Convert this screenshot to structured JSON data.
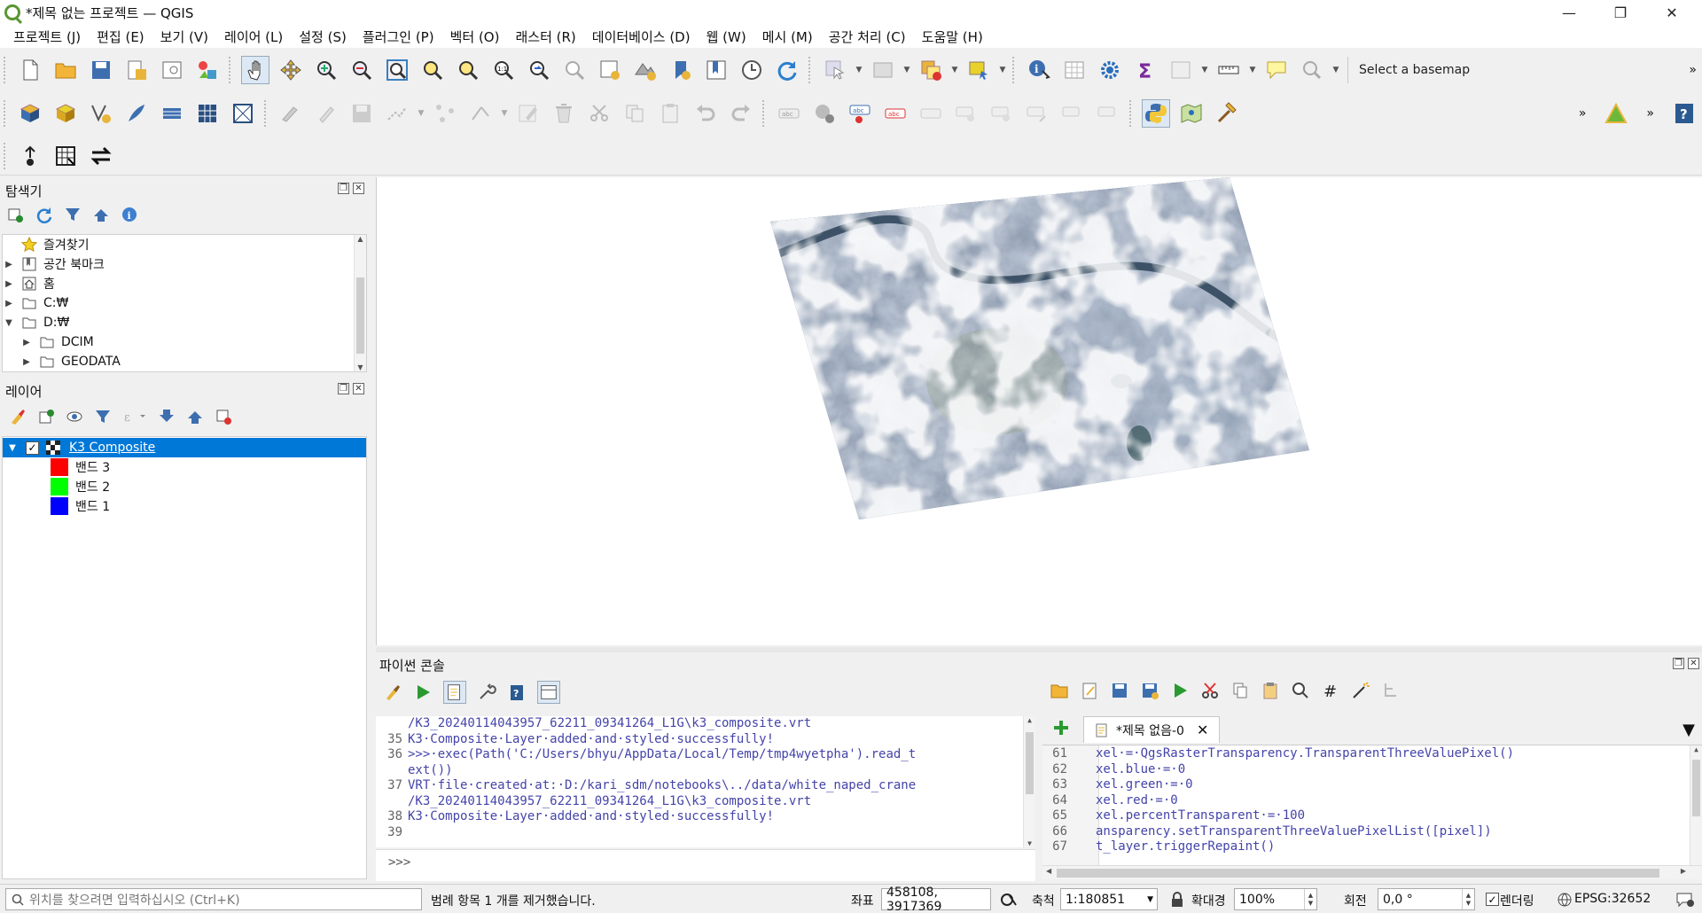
{
  "window": {
    "title": "*제목 없는 프로젝트 — QGIS",
    "minimize": "—",
    "restore": "❐",
    "close": "✕"
  },
  "menu": [
    "프로젝트 (J)",
    "편집 (E)",
    "보기 (V)",
    "레이어 (L)",
    "설정 (S)",
    "플러그인 (P)",
    "벡터 (O)",
    "래스터 (R)",
    "데이터베이스 (D)",
    "웹 (W)",
    "메시 (M)",
    "공간 처리 (C)",
    "도움말 (H)"
  ],
  "toolbar": {
    "basemap_label": "Select a basemap",
    "overflow": "»"
  },
  "browser": {
    "title": "탐색기",
    "items": [
      {
        "label": "즐겨찾기",
        "icon": "star-icon",
        "arrow": ""
      },
      {
        "label": "공간 북마크",
        "icon": "bookmark-icon",
        "arrow": "▶"
      },
      {
        "label": "홈",
        "icon": "home-icon",
        "arrow": "▶"
      },
      {
        "label": "C:₩",
        "icon": "drive-icon",
        "arrow": "▶"
      },
      {
        "label": "D:₩",
        "icon": "drive-icon",
        "arrow": "▼"
      },
      {
        "label": "DCIM",
        "icon": "folder-icon",
        "arrow": "▶"
      },
      {
        "label": "GEODATA",
        "icon": "folder-icon",
        "arrow": "▶"
      }
    ]
  },
  "layers": {
    "title": "레이어",
    "layer_name": "K3 Composite",
    "bands": [
      {
        "label": "밴드 3",
        "color": "#ff0000"
      },
      {
        "label": "밴드 2",
        "color": "#00ff00"
      },
      {
        "label": "밴드 1",
        "color": "#0000ff"
      }
    ]
  },
  "console": {
    "title": "파이썬 콘솔",
    "output_lines": [
      {
        "num": "",
        "text": "/K3_20240114043957_62211_09341264_L1G\\k3_composite.vrt"
      },
      {
        "num": "35",
        "text": "K3·Composite·Layer·added·and·styled·successfully!"
      },
      {
        "num": "36",
        "text": ">>>·exec(Path('C:/Users/bhyu/AppData/Local/Temp/tmp4wyetpha').read_t"
      },
      {
        "num": "",
        "text": "ext())"
      },
      {
        "num": "37",
        "text": "VRT·file·created·at:·D:/kari_sdm/notebooks\\../data/white_naped_crane"
      },
      {
        "num": "",
        "text": "/K3_20240114043957_62211_09341264_L1G\\k3_composite.vrt"
      },
      {
        "num": "38",
        "text": "K3·Composite·Layer·added·and·styled·successfully!"
      },
      {
        "num": "39",
        "text": ""
      }
    ],
    "prompt": ">>>",
    "editor_tab": "*제목 없음-0",
    "editor_lines": [
      {
        "num": "61",
        "text": "xel·=·QgsRasterTransparency.TransparentThreeValuePixel()"
      },
      {
        "num": "62",
        "text": "xel.blue·=·0"
      },
      {
        "num": "63",
        "text": "xel.green·=·0"
      },
      {
        "num": "64",
        "text": "xel.red·=·0"
      },
      {
        "num": "65",
        "text": "xel.percentTransparent·=·100"
      },
      {
        "num": "66",
        "text": "ansparency.setTransparentThreeValuePixelList([pixel])"
      },
      {
        "num": "67",
        "text": "t_layer.triggerRepaint()"
      }
    ]
  },
  "status": {
    "locator_placeholder": "위치를 찾으려면 입력하십시오 (Ctrl+K)",
    "message": "범례 항목 1 개를 제거했습니다.",
    "coord_label": "좌표",
    "coord_value": "458108, 3917369",
    "scale_label": "축척",
    "scale_value": "1:180851",
    "magnifier_label": "확대경",
    "magnifier_value": "100%",
    "rotation_label": "회전",
    "rotation_value": "0,0 °",
    "render_label": "렌더링",
    "crs": "EPSG:32652"
  }
}
